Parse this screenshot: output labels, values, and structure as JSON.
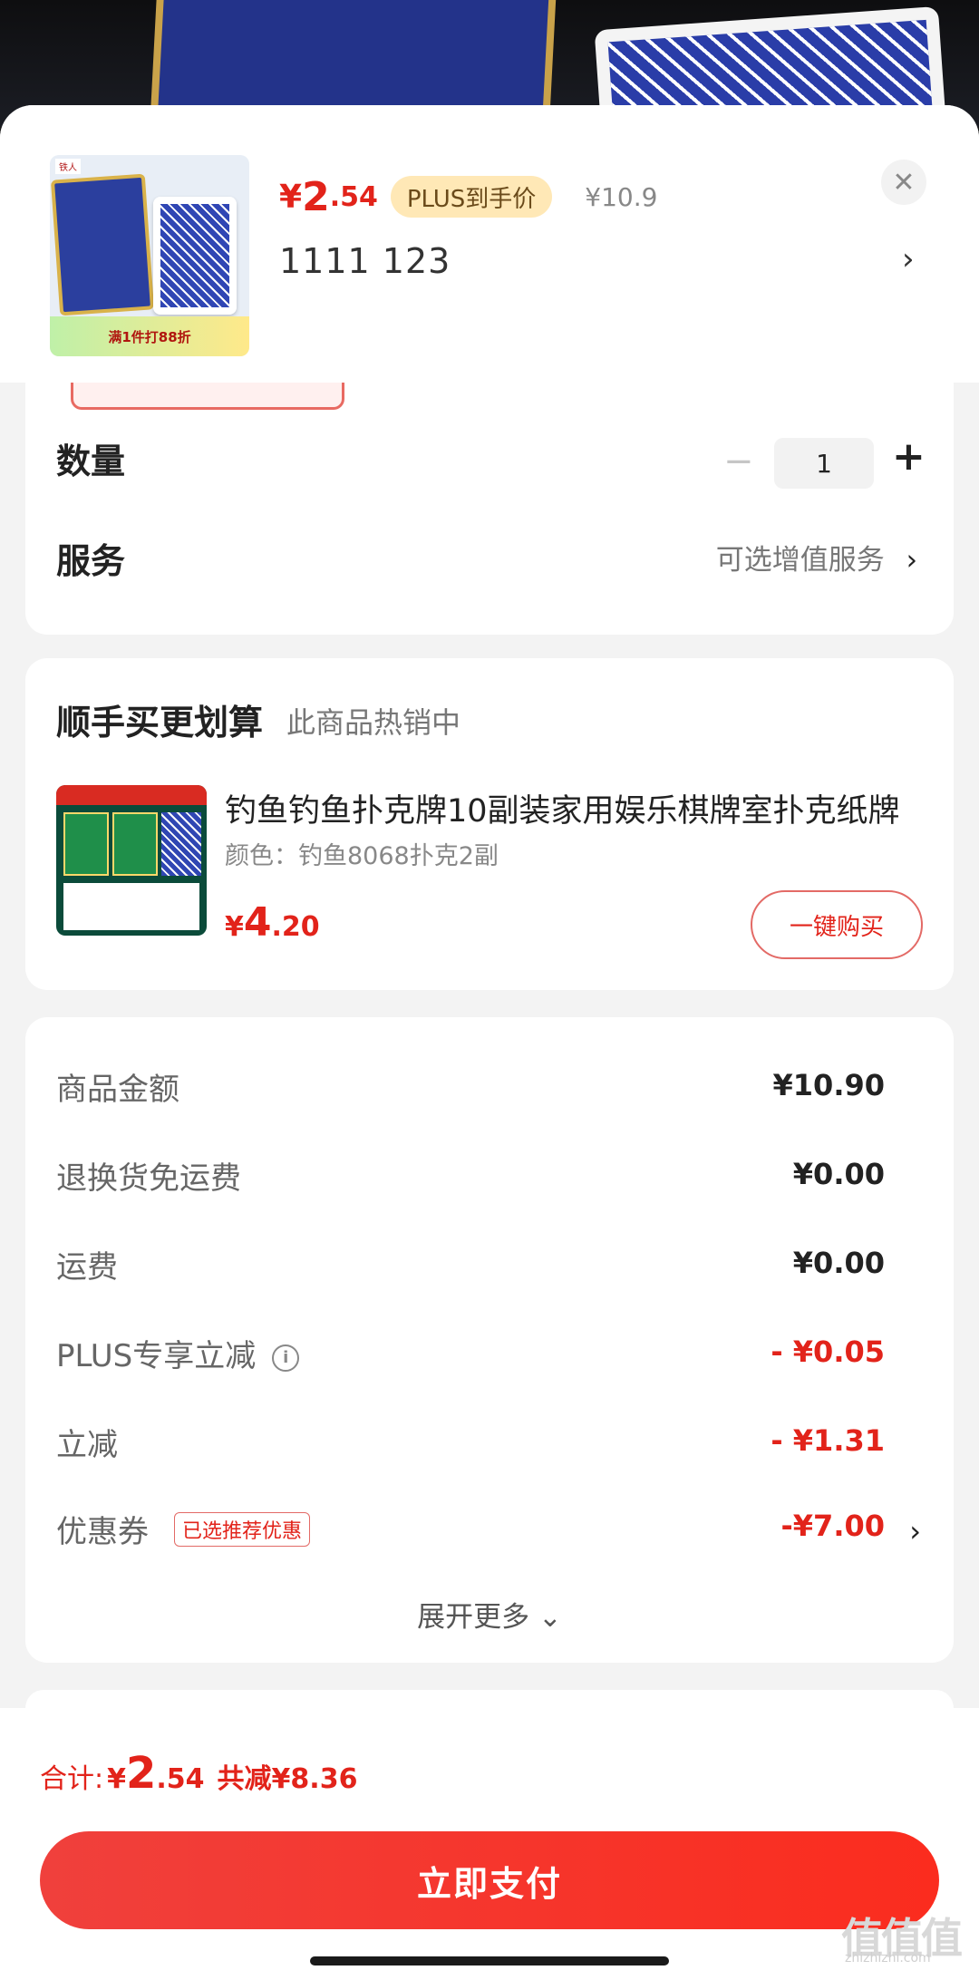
{
  "product": {
    "price_yen": "¥",
    "price_int": "2",
    "price_dec": ".54",
    "plus_badge": "PLUS到手价",
    "original_price": "¥10.9",
    "variant": "1111  123",
    "thumb_promo": "满1件打88折"
  },
  "options": {
    "quantity_label": "数量",
    "quantity_value": "1",
    "minus": "−",
    "plus": "+",
    "service_label": "服务",
    "service_value": "可选增值服务"
  },
  "recommend": {
    "title": "顺手买更划算",
    "subtitle": "此商品热销中",
    "item_title": "钓鱼钓鱼扑克牌10副装家用娱乐棋牌室扑克纸牌",
    "item_color": "颜色：钓鱼8068扑克2副",
    "price_yen": "¥",
    "price_int": "4",
    "price_dec": ".20",
    "buy_label": "一键购买"
  },
  "fees": {
    "items": [
      {
        "label": "商品金额",
        "value": "¥10.90"
      },
      {
        "label": "退换货免运费",
        "value": "¥0.00"
      },
      {
        "label": "运费",
        "value": "¥0.00"
      },
      {
        "label": "PLUS专享立减",
        "value": "- ¥0.05"
      },
      {
        "label": "立减",
        "value": "- ¥1.31"
      },
      {
        "label": "优惠券",
        "value": "-¥7.00"
      }
    ],
    "coupon_tag": "已选推荐优惠",
    "expand_label": "展开更多 ⌄"
  },
  "footer": {
    "total_label": "合计:",
    "total_yen": "¥",
    "total_int": "2",
    "total_dec": ".54",
    "saved": "共减¥8.36",
    "pay_label": "立即支付",
    "watermark": "值值值",
    "watermark_sub": "zhizhizhi.com"
  },
  "colors": {
    "accent_red": "#e2231a",
    "plus_gold": "#ffe8b6"
  }
}
